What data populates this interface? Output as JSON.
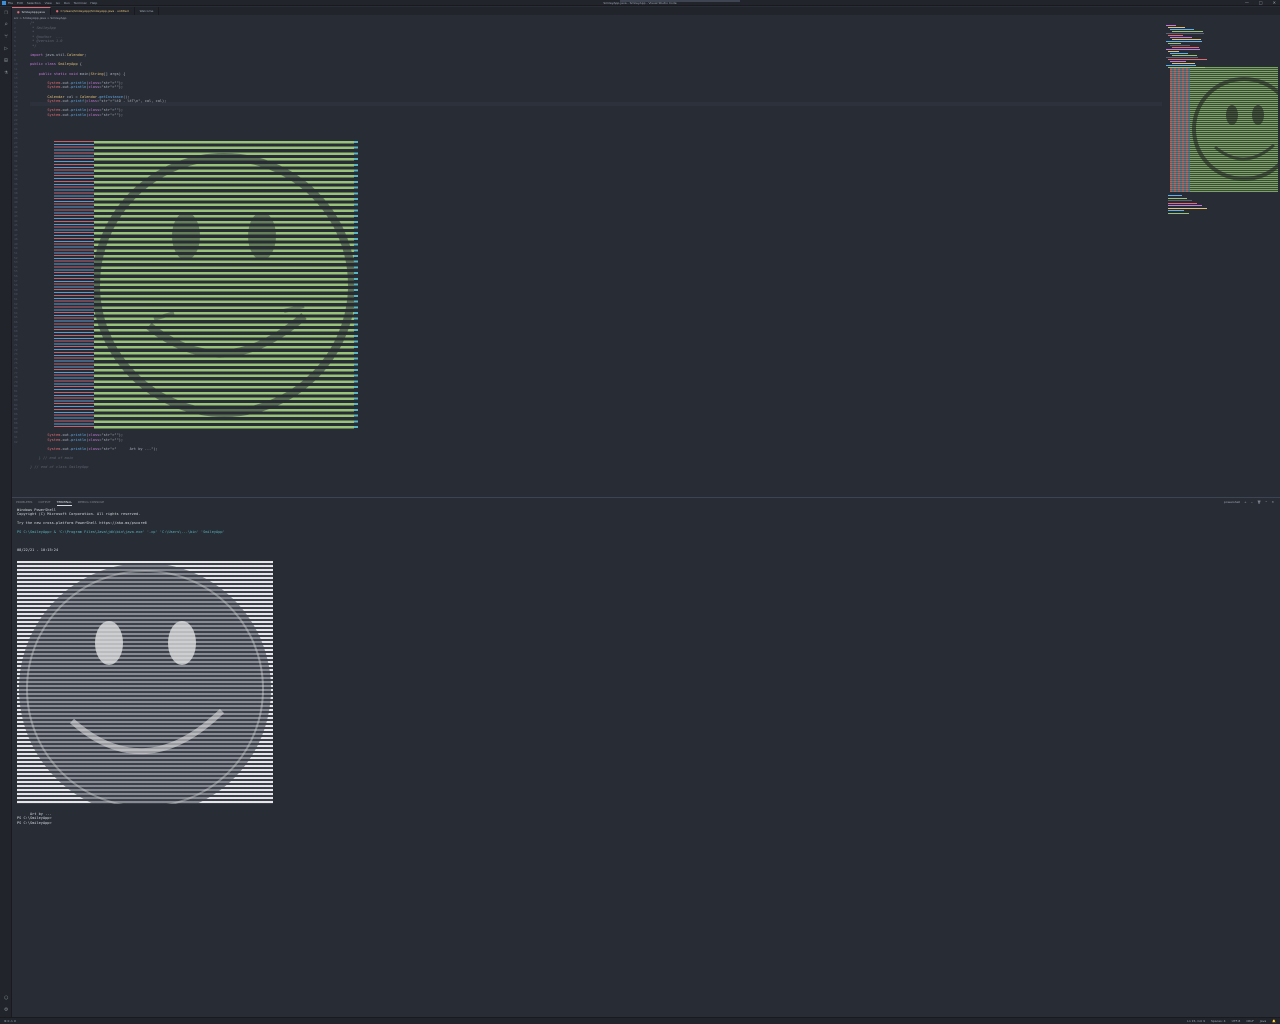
{
  "window": {
    "title": "SmileyApp.java - SmileyApp - Visual Studio Code",
    "menus": [
      "File",
      "Edit",
      "Selection",
      "View",
      "Go",
      "Run",
      "Terminal",
      "Help"
    ],
    "controls": [
      "—",
      "□",
      "✕"
    ]
  },
  "tabs": [
    {
      "label": "SmileyApp.java",
      "active": true
    },
    {
      "label": "C:\\Users\\SmileyApp\\SmileyApp.java · untitled",
      "active": false
    },
    {
      "label": "Welcome",
      "active": false
    }
  ],
  "breadcrumb": "src > SmileyApp.java > SmileyApp",
  "editor": {
    "header_lines": [
      "/*",
      " * SmileyApp",
      " *",
      " * @author  ...",
      " * @version 1.0",
      " */",
      "",
      "import java.util.Calendar;",
      "",
      "public class SmileyApp {",
      "",
      "    public static void main(String[] args) {",
      "",
      "        System.out.println(\"\");",
      "        System.out.println(\"\");",
      "",
      "        Calendar cal = Calendar.getInstance();",
      "        System.out.printf(\"%tD - %tT\\n\", cal, cal);",
      "",
      "        System.out.println(\"\");",
      "        System.out.println(\"\");"
    ],
    "footer_lines": [
      "        System.out.println(\"\");",
      "        System.out.println(\"\");",
      "",
      "        System.out.println(\"      Art by ...\");",
      "",
      "    } // end of main",
      "",
      "} // end of class SmileyApp"
    ]
  },
  "panel": {
    "tabs": [
      "PROBLEMS",
      "OUTPUT",
      "TERMINAL",
      "DEBUG CONSOLE"
    ],
    "active_tab": "TERMINAL",
    "actions": [
      "powershell",
      "+",
      "⌄",
      "🗑",
      "^",
      "✕"
    ],
    "terminal": {
      "lines": [
        "Windows PowerShell",
        "Copyright (C) Microsoft Corporation. All rights reserved.",
        "",
        "Try the new cross-platform PowerShell https://aka.ms/pscore6",
        "",
        "PS C:\\SmileyApp> & 'C:\\Program Files\\Java\\jdk\\bin\\java.exe' '-cp' 'C:\\Users\\...\\bin' 'SmileyApp'"
      ],
      "timestamp": "08/22/21 - 10:15:24",
      "after": [
        "      Art by ...",
        "PS C:\\SmileyApp>",
        "PS C:\\SmileyApp> "
      ]
    }
  },
  "status": {
    "left": [
      "⊗ 0 ⚠ 0"
    ],
    "right": [
      "Ln 15, Col 9",
      "Spaces: 4",
      "UTF-8",
      "CRLF",
      "Java",
      "🔔"
    ]
  },
  "colors": {
    "background": "#282c34",
    "accent": "#e06c75",
    "string": "#98c379",
    "keyword": "#c678dd"
  }
}
